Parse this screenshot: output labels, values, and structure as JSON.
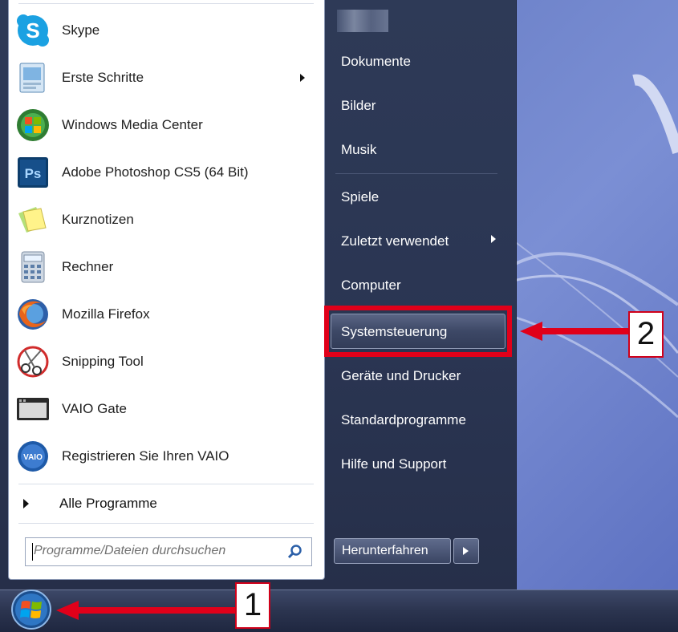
{
  "programs": [
    {
      "label": "Skype",
      "icon": "skype-icon",
      "has_submenu": false
    },
    {
      "label": "Erste Schritte",
      "icon": "getting-started-icon",
      "has_submenu": true
    },
    {
      "label": "Windows Media Center",
      "icon": "media-center-icon",
      "has_submenu": false
    },
    {
      "label": "Adobe Photoshop CS5 (64 Bit)",
      "icon": "photoshop-icon",
      "has_submenu": false
    },
    {
      "label": "Kurznotizen",
      "icon": "sticky-notes-icon",
      "has_submenu": false
    },
    {
      "label": "Rechner",
      "icon": "calculator-icon",
      "has_submenu": false
    },
    {
      "label": "Mozilla Firefox",
      "icon": "firefox-icon",
      "has_submenu": false
    },
    {
      "label": "Snipping Tool",
      "icon": "snipping-tool-icon",
      "has_submenu": false
    },
    {
      "label": "VAIO Gate",
      "icon": "vaio-gate-icon",
      "has_submenu": false
    },
    {
      "label": "Registrieren Sie Ihren VAIO",
      "icon": "vaio-register-icon",
      "has_submenu": false
    }
  ],
  "all_programs": "Alle Programme",
  "search": {
    "placeholder": "Programme/Dateien durchsuchen"
  },
  "right": {
    "documents": "Dokumente",
    "pictures": "Bilder",
    "music": "Musik",
    "games": "Spiele",
    "recent": "Zuletzt verwendet",
    "computer": "Computer",
    "control_panel": "Systemsteuerung",
    "devices": "Geräte und Drucker",
    "default_programs": "Standardprogramme",
    "help": "Hilfe und Support"
  },
  "shutdown": {
    "label": "Herunterfahren"
  },
  "callouts": {
    "one": "1",
    "two": "2"
  },
  "colors": {
    "highlight": "#e0001a",
    "menu_dark": "#2e3a57",
    "desktop": "#6d82c9"
  }
}
